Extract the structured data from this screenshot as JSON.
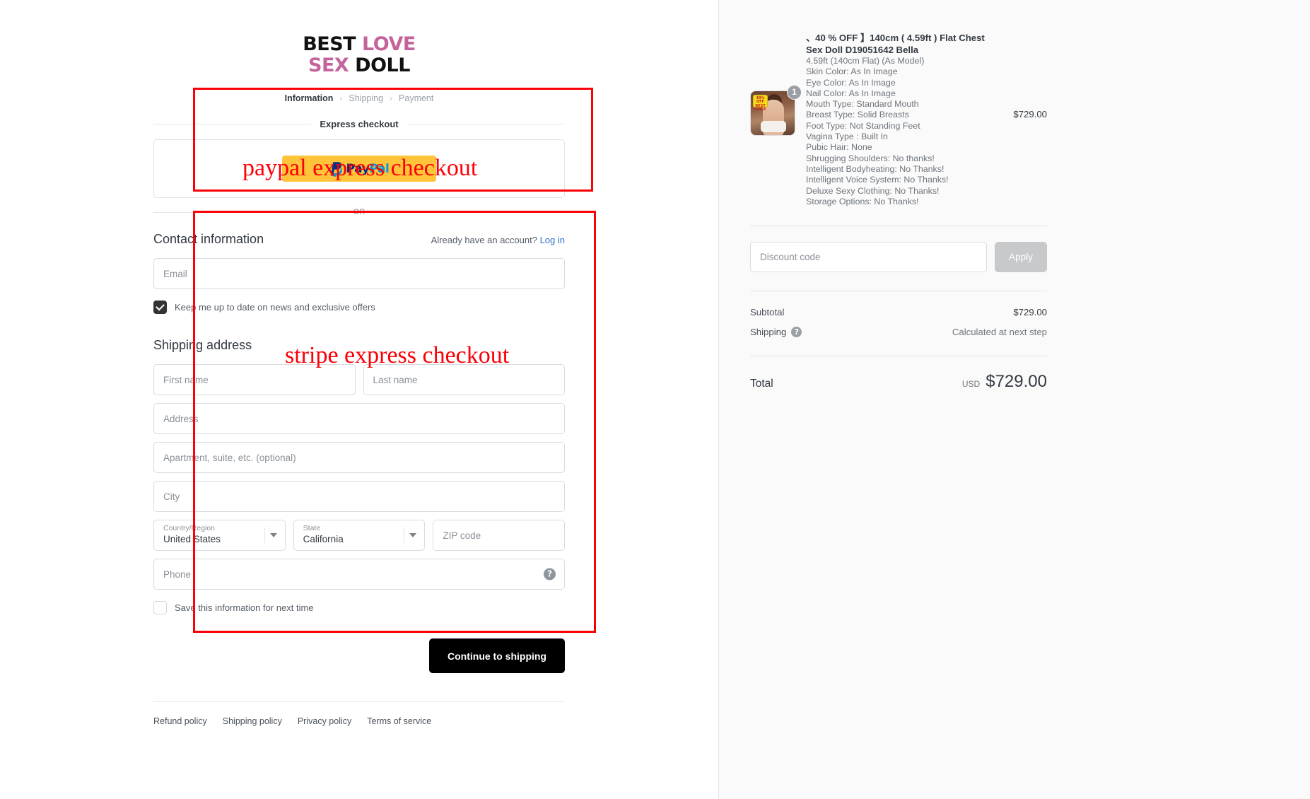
{
  "brand": {
    "line1_black": "BEST",
    "line1_pink": "LOVE",
    "line2_pink": "SEX",
    "line2_black": "DOLL"
  },
  "breadcrumb": {
    "information": "Information",
    "shipping": "Shipping",
    "payment": "Payment",
    "separator": "›"
  },
  "express": {
    "title": "Express checkout",
    "paypal_pay": "Pay",
    "paypal_pal": "Pal",
    "or": "OR"
  },
  "contact": {
    "title": "Contact information",
    "account_prompt": "Already have an account?",
    "login_label": "Log in",
    "email_placeholder": "Email",
    "newsletter_label": "Keep me up to date on news and exclusive offers",
    "newsletter_checked": true
  },
  "shipping_address": {
    "title": "Shipping address",
    "first_name_placeholder": "First name",
    "last_name_placeholder": "Last name",
    "address_placeholder": "Address",
    "apartment_placeholder": "Apartment, suite, etc. (optional)",
    "city_placeholder": "City",
    "country_label": "Country/Region",
    "country_value": "United States",
    "state_label": "State",
    "state_value": "California",
    "zip_placeholder": "ZIP code",
    "phone_placeholder": "Phone",
    "phone_help_icon": "question-mark-icon",
    "save_info_label": "Save this information for next time",
    "save_info_checked": false,
    "continue_label": "Continue to shipping"
  },
  "footer": {
    "links": [
      "Refund policy",
      "Shipping policy",
      "Privacy policy",
      "Terms of service"
    ]
  },
  "order_summary": {
    "item": {
      "title": "、40 % OFF 】140cm ( 4.59ft ) Flat Chest Sex Doll D19051642 Bella",
      "quantity": "1",
      "price": "$729.00",
      "thumb_badge": "40% OFF BEST PRICE",
      "options": [
        "4.59ft (140cm Flat) (As Model)",
        "Skin Color: As In Image",
        "Eye Color: As In Image",
        "Nail Color: As In Image",
        "Mouth Type: Standard Mouth",
        "Breast Type: Solid Breasts",
        "Foot Type: Not Standing Feet",
        "Vagina Type : Built In",
        "Pubic Hair: None",
        "Shrugging Shoulders: No thanks!",
        "Intelligent Bodyheating: No Thanks!",
        "Intelligent Voice System: No Thanks!",
        "Deluxe Sexy Clothing: No Thanks!",
        "Storage Options: No Thanks!"
      ]
    },
    "discount_placeholder": "Discount code",
    "apply_label": "Apply",
    "subtotal_label": "Subtotal",
    "subtotal_value": "$729.00",
    "shipping_label": "Shipping",
    "shipping_value": "Calculated at next step",
    "shipping_help_icon": "question-mark-icon",
    "total_label": "Total",
    "total_currency": "USD",
    "total_value": "$729.00"
  },
  "annotations": {
    "paypal_note": "paypal express checkout",
    "stripe_note": "stripe express checkout",
    "color": "#fb0007"
  }
}
